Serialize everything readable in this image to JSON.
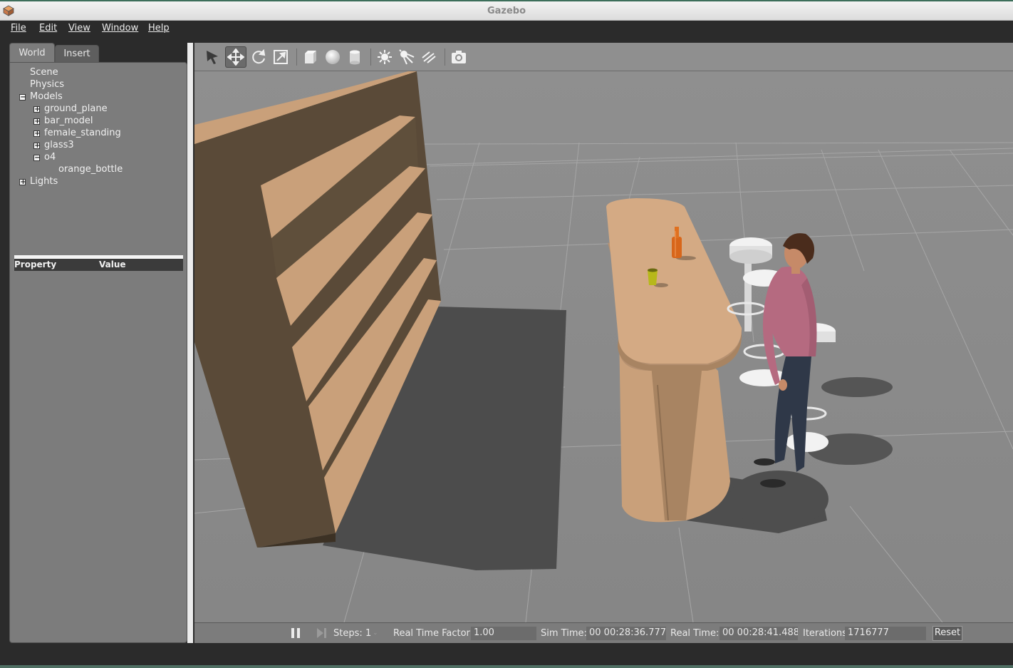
{
  "window": {
    "title": "Gazebo",
    "app_icon": "gazebo-icon"
  },
  "menu": {
    "items": [
      "File",
      "Edit",
      "View",
      "Window",
      "Help"
    ]
  },
  "left_panel": {
    "tabs": [
      "World",
      "Insert"
    ],
    "active_tab": "World",
    "tree": {
      "scene": "Scene",
      "physics": "Physics",
      "models": "Models",
      "ground_plane": "ground_plane",
      "bar_model": "bar_model",
      "female_standing": "female_standing",
      "glass3": "glass3",
      "o4": "o4",
      "orange_bottle": "orange_bottle",
      "lights": "Lights"
    },
    "property_table": {
      "headers": [
        "Property",
        "Value"
      ]
    }
  },
  "toolbar": {
    "tools": [
      "select-arrow-icon",
      "translate-icon",
      "rotate-icon",
      "scale-icon",
      "box-icon",
      "sphere-icon",
      "cylinder-icon",
      "point-light-icon",
      "spot-light-icon",
      "directional-light-icon",
      "screenshot-icon"
    ],
    "active_tool": "translate-icon"
  },
  "status": {
    "steps_label": "Steps:",
    "steps_value": "1",
    "rtf_label": "Real Time Factor:",
    "rtf_value": "1.00",
    "sim_time_label": "Sim Time:",
    "sim_time_value": "00 00:28:36.777",
    "real_time_label": "Real Time:",
    "real_time_value": "00 00:28:41.488",
    "iterations_label": "Iterations:",
    "iterations_value": "1716777",
    "reset_label": "Reset"
  },
  "colors": {
    "wood": "#c9a07a",
    "wood_dark": "#5a4a38",
    "ground": "#8c8c8c",
    "bottle": "#d8661a",
    "glass": "#b7b81a",
    "shirt": "#b56a80"
  }
}
